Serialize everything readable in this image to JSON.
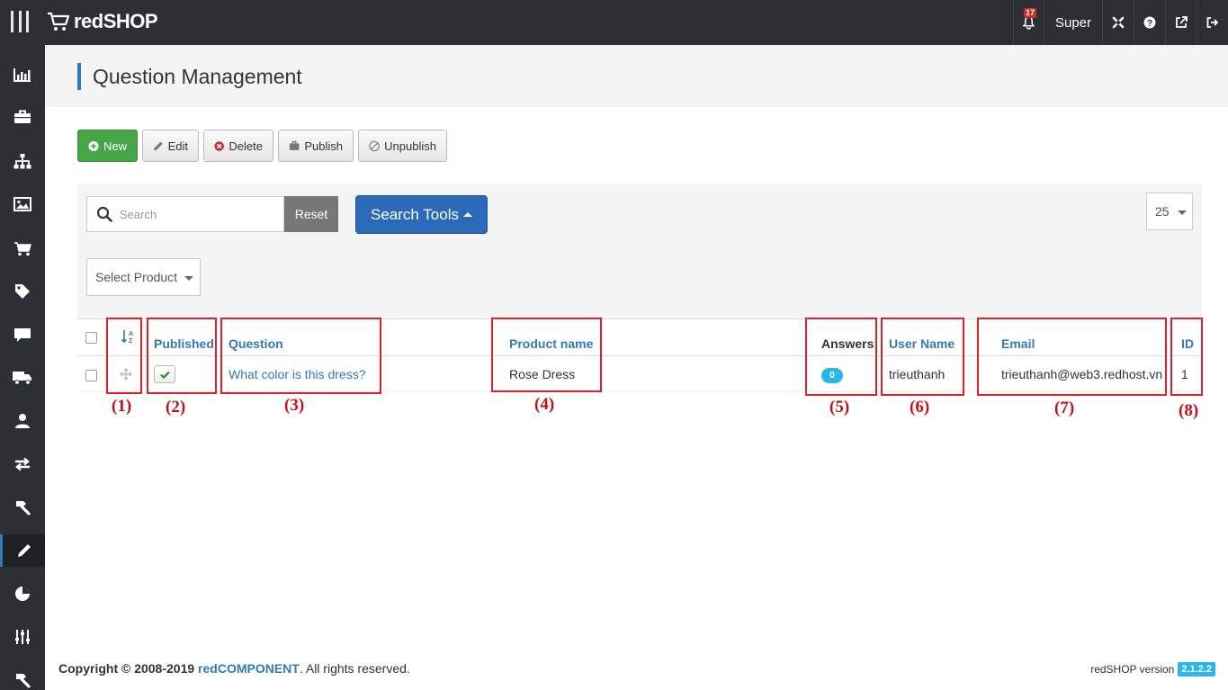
{
  "app": {
    "brand": "redSHOP",
    "notification_count": "17",
    "user": "Super"
  },
  "sidebar": {
    "items": [
      {
        "icon": "bar-chart-icon"
      },
      {
        "icon": "briefcase-icon"
      },
      {
        "icon": "sitemap-icon"
      },
      {
        "icon": "image-icon"
      },
      {
        "icon": "cart-icon"
      },
      {
        "icon": "tag-icon"
      },
      {
        "icon": "comment-icon"
      },
      {
        "icon": "truck-icon"
      },
      {
        "icon": "user-icon"
      },
      {
        "icon": "exchange-icon"
      },
      {
        "icon": "hammer-icon"
      },
      {
        "icon": "pencil-icon",
        "active": true
      },
      {
        "icon": "pie-chart-icon"
      },
      {
        "icon": "sliders-icon"
      },
      {
        "icon": "hammer-icon"
      }
    ]
  },
  "page": {
    "title": "Question Management"
  },
  "toolbar": {
    "new": "New",
    "edit": "Edit",
    "delete": "Delete",
    "publish": "Publish",
    "unpublish": "Unpublish"
  },
  "filters": {
    "search_placeholder": "Search",
    "reset": "Reset",
    "search_tools": "Search Tools",
    "limit": "25",
    "product": "Select Product"
  },
  "table": {
    "headers": {
      "published": "Published",
      "question": "Question",
      "product_name": "Product name",
      "answers": "Answers",
      "user_name": "User Name",
      "email": "Email",
      "id": "ID"
    },
    "rows": [
      {
        "published": true,
        "question": "What color is this dress?",
        "product_name": "Rose Dress",
        "answers": "0",
        "user_name": "trieuthanh",
        "email": "trieuthanh@web3.redhost.vn",
        "id": "1"
      }
    ]
  },
  "annotations": [
    "(1)",
    "(2)",
    "(3)",
    "(4)",
    "(5)",
    "(6)",
    "(7)",
    "(8)"
  ],
  "footer": {
    "copyright_prefix": "Copyright © 2008-2019",
    "company": "redCOMPONENT",
    "copyright_suffix": ". All rights reserved.",
    "version_label": "redSHOP version",
    "version": "2.1.2.2"
  },
  "colors": {
    "topbar": "#2c2f33",
    "accent": "#337ab7",
    "new_button": "#46a546",
    "annotation": "#e0202a",
    "badge": "#2ab6e8"
  }
}
